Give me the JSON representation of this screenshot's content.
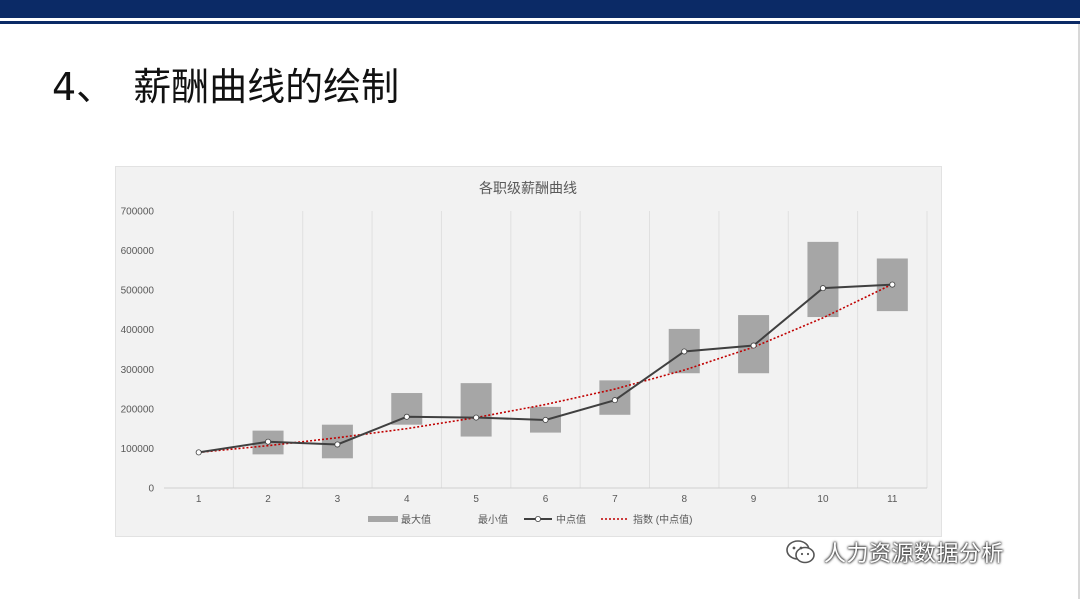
{
  "slide": {
    "title": "4、　薪酬曲线的绘制"
  },
  "watermark": {
    "text": "人力资源数据分析",
    "icon": "wechat-icon"
  },
  "colors": {
    "header_bar": "#0b2a66",
    "range_bar": "#a6a6a6",
    "midpoint_line": "#404040",
    "trend_line": "#c00000",
    "panel_bg": "#f2f2f2"
  },
  "chart_data": {
    "type": "bar",
    "title": "各职级薪酬曲线",
    "categories": [
      "1",
      "2",
      "3",
      "4",
      "5",
      "6",
      "7",
      "8",
      "9",
      "10",
      "11"
    ],
    "ylim": [
      0,
      700000
    ],
    "yticks": [
      0,
      100000,
      200000,
      300000,
      400000,
      500000,
      600000,
      700000
    ],
    "ytick_labels": [
      "0",
      "100000",
      "200000",
      "300000",
      "400000",
      "500000",
      "600000",
      "700000"
    ],
    "grid": "vertical",
    "legend_position": "bottom",
    "series": [
      {
        "name": "最大值",
        "type": "bar",
        "values": [
          90000,
          145000,
          160000,
          240000,
          265000,
          205000,
          272000,
          402000,
          437000,
          622000,
          580000
        ]
      },
      {
        "name": "最小值",
        "type": "bar",
        "values": [
          90000,
          85000,
          75000,
          160000,
          130000,
          140000,
          185000,
          290000,
          290000,
          432000,
          447000
        ]
      },
      {
        "name": "中点值",
        "type": "line",
        "values": [
          90000,
          117000,
          110000,
          180000,
          178000,
          172000,
          222000,
          345000,
          360000,
          505000,
          514000
        ]
      },
      {
        "name": "指数 (中点值)",
        "type": "trendline",
        "values": [
          90000,
          107000,
          127000,
          150000,
          178000,
          211000,
          250000,
          298000,
          356000,
          430000,
          515000
        ]
      }
    ]
  }
}
